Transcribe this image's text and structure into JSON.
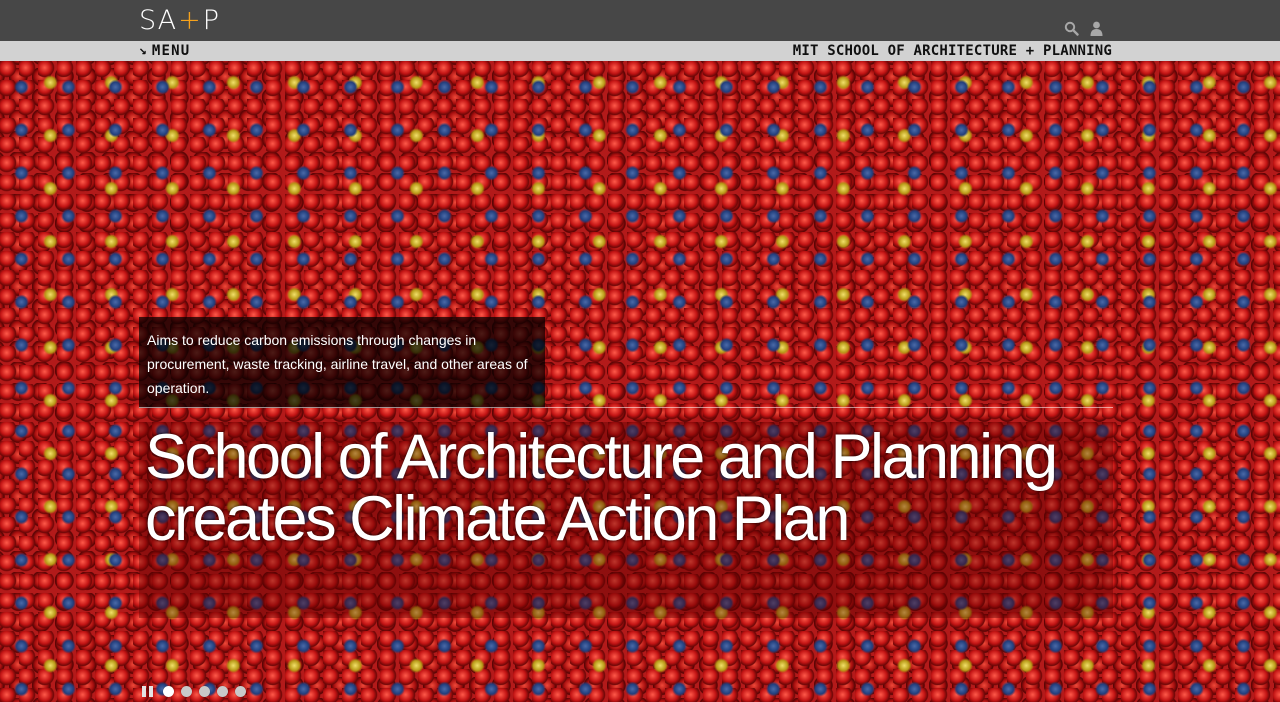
{
  "header": {
    "logo": {
      "part1": "SA",
      "plus": "+",
      "part2": "P"
    },
    "icons": [
      "search-icon",
      "user-icon"
    ]
  },
  "subnav": {
    "menu_arrow": "↘",
    "menu_label": "MENU",
    "school_name": "MIT SCHOOL OF ARCHITECTURE + PLANNING"
  },
  "hero": {
    "caption": "Aims to reduce carbon emissions through changes in procurement, waste tracking, airline travel, and other areas of operation.",
    "headline": "School of Architecture and Planning creates Climate Action Plan",
    "slides_count": 5,
    "active_slide": 1
  },
  "colors": {
    "topbar": "#474747",
    "subbar": "#d2d2d2",
    "logo_accent": "#f7a21b",
    "sphere_red": "#c31414",
    "sphere_blue": "#223e7c",
    "sphere_yellow": "#b89a17"
  }
}
